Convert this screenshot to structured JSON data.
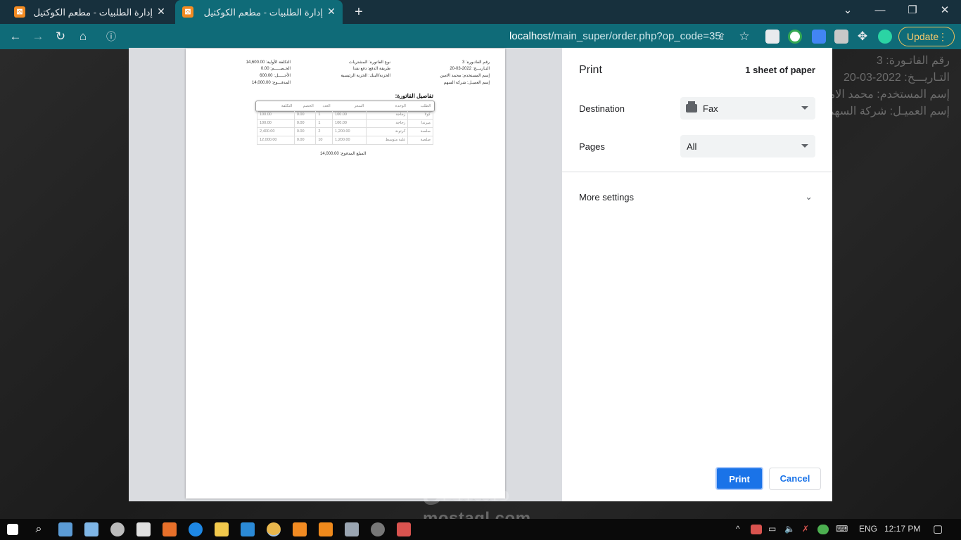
{
  "browser": {
    "tabs": [
      {
        "title": "إدارة الطلبيات - مطعم الكوكتيل",
        "active": false
      },
      {
        "title": "إدارة الطلبيات - مطعم الكوكتيل",
        "active": true
      }
    ],
    "new_tab_icon": "plus-icon",
    "url_host": "localhost",
    "url_path": "/main_super/order.php?op_code=35",
    "update_label": "Update"
  },
  "background_page": {
    "lines": [
      "رقم الفاتـورة: 3",
      "التـاريـــخ: 2022-03-20",
      "إسم المستخدم: محمد الامين",
      "إسم العميـل: شركة السهم"
    ]
  },
  "print_preview": {
    "right_col": [
      "رقم الفاتـورة: 3",
      "التـاريـــخ: 2022-03-20",
      "إسم المستخدم: محمد الامين",
      "إسم العميـل: شركة السهم"
    ],
    "mid_col": [
      "نوع الفاتورة: المشتريات",
      "طريقة الدفع: دفع نقدا",
      "الخزنة/البنك: الخزنة الرئيسية"
    ],
    "left_col": [
      "التكلفة الأولية: 14,600.00",
      "الخـصـــــم: 0.00",
      "الأجـــــل: 600.00",
      "المدفـــوع: 14,000.00"
    ],
    "details_title": "تفاصيل الفاتورة:",
    "table": {
      "headers": [
        "الطلب",
        "الوحدة",
        "السعر",
        "العدد",
        "الخصم",
        "التكلفة"
      ],
      "rows": [
        [
          "كولا",
          "زجاجة",
          "100.00",
          "1",
          "0.00",
          "100.00"
        ],
        [
          "ميرندا",
          "زجاجة",
          "100.00",
          "1",
          "0.00",
          "100.00"
        ],
        [
          "صلصة",
          "كرتونة",
          "1,200.00",
          "2",
          "0.00",
          "2,400.00"
        ],
        [
          "صلصة",
          "علبة متوسط",
          "1,200.00",
          "10",
          "0.00",
          "12,000.00"
        ]
      ]
    },
    "total_paid": "المبلغ المدفوع: 14,000.00"
  },
  "print_panel": {
    "title": "Print",
    "sheets": "1 sheet of paper",
    "destination_label": "Destination",
    "destination_value": "Fax",
    "pages_label": "Pages",
    "pages_value": "All",
    "more_settings": "More settings",
    "print_button": "Print",
    "cancel_button": "Cancel"
  },
  "watermark": {
    "arabic": "مستقل",
    "latin": "mostaql.com"
  },
  "taskbar": {
    "language": "ENG",
    "time": "12:17 PM"
  }
}
